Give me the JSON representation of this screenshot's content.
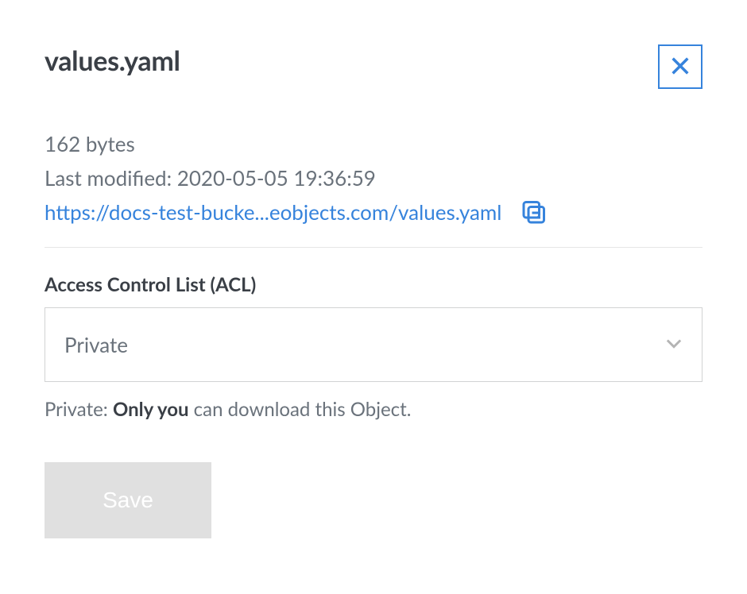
{
  "title": "values.yaml",
  "file": {
    "size": "162 bytes",
    "last_modified_label": "Last modified: 2020-05-05 19:36:59",
    "url": "https://docs-test-bucke...eobjects.com/values.yaml"
  },
  "acl": {
    "label": "Access Control List (ACL)",
    "selected": "Private",
    "helper_prefix": "Private: ",
    "helper_strong": "Only you",
    "helper_suffix": " can download this Object."
  },
  "buttons": {
    "save": "Save"
  }
}
